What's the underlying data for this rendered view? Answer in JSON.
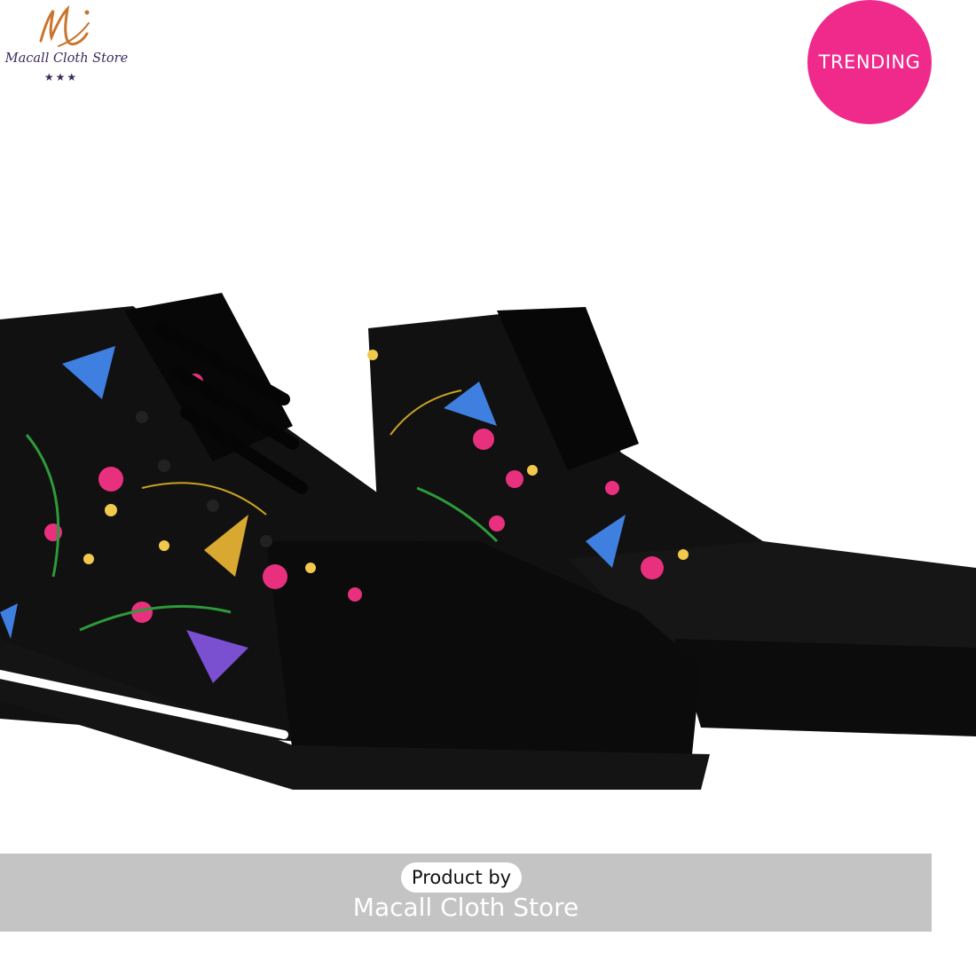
{
  "logo": {
    "text": "Macall Cloth Store",
    "stars": "★★★",
    "colors": {
      "mark": "#c9752e",
      "text": "#3b2a5a"
    }
  },
  "badge": {
    "label": "TRENDING",
    "color": "#ef2a8b"
  },
  "photo": {
    "subject": "pair of black high-top sneakers with embroidered hummingbird and flower print",
    "colors": {
      "canvas": "#111111",
      "sole": "#141414",
      "flower_pink": "#e8307f",
      "hummingbird_blue": "#3f7fe0"
    }
  },
  "banner": {
    "label": "Product by",
    "store_name": "Macall Cloth Store",
    "color": "#c4c4c4"
  }
}
